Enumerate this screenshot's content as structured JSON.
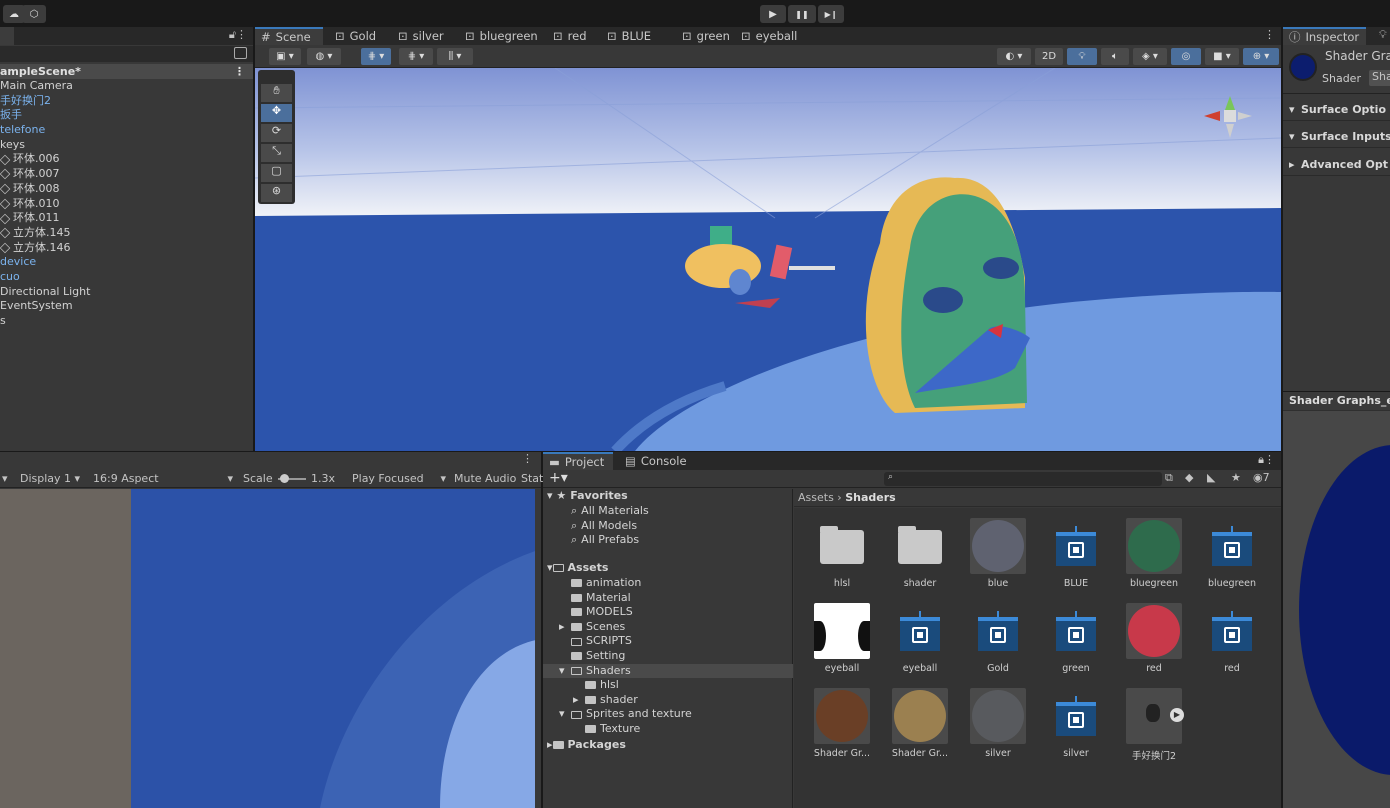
{
  "playbar": {
    "play": "▶",
    "pause": "❚❚",
    "step": "▶❙"
  },
  "hierarchy": {
    "scene": "ampleScene*",
    "items": [
      {
        "label": "Main Camera",
        "style": "normal",
        "icon": false
      },
      {
        "label": "手好换门2",
        "style": "blue",
        "icon": false
      },
      {
        "label": "扳手",
        "style": "blue",
        "icon": false
      },
      {
        "label": "telefone",
        "style": "blue",
        "icon": false
      },
      {
        "label": "keys",
        "style": "normal",
        "icon": false
      },
      {
        "label": "环体.006",
        "style": "normal",
        "icon": true
      },
      {
        "label": "环体.007",
        "style": "normal",
        "icon": true
      },
      {
        "label": "环体.008",
        "style": "normal",
        "icon": true
      },
      {
        "label": "环体.010",
        "style": "normal",
        "icon": true
      },
      {
        "label": "环体.011",
        "style": "normal",
        "icon": true
      },
      {
        "label": "立方体.145",
        "style": "normal",
        "icon": true
      },
      {
        "label": "立方体.146",
        "style": "normal",
        "icon": true
      },
      {
        "label": "device",
        "style": "blue",
        "icon": false
      },
      {
        "label": "cuo",
        "style": "blue",
        "icon": false
      },
      {
        "label": "Directional Light",
        "style": "normal",
        "icon": false
      },
      {
        "label": "EventSystem",
        "style": "normal",
        "icon": false
      },
      {
        "label": "s",
        "style": "normal",
        "icon": false
      }
    ]
  },
  "sceneTabs": [
    "Scene",
    "Gold",
    "silver",
    "bluegreen",
    "red",
    "BLUE",
    "green",
    "eyeball"
  ],
  "sceneToolbar": {
    "twoD": "2D"
  },
  "game": {
    "display": "Display 1",
    "aspect": "16:9 Aspect",
    "scale_label": "Scale",
    "scale_value": "1.3x",
    "play_focused": "Play Focused",
    "mute": "Mute Audio",
    "stats": "Stat"
  },
  "project": {
    "tabs": [
      "Project",
      "Console"
    ],
    "favorites_label": "Favorites",
    "favorites": [
      "All Materials",
      "All Models",
      "All Prefabs"
    ],
    "assets_label": "Assets",
    "folders": [
      {
        "label": "animation",
        "depth": 1
      },
      {
        "label": "Material",
        "depth": 1
      },
      {
        "label": "MODELS",
        "depth": 1
      },
      {
        "label": "Scenes",
        "depth": 1
      },
      {
        "label": "SCRIPTS",
        "depth": 1
      },
      {
        "label": "Setting",
        "depth": 1
      },
      {
        "label": "Shaders",
        "depth": 1
      },
      {
        "label": "hlsl",
        "depth": 2
      },
      {
        "label": "shader",
        "depth": 2
      },
      {
        "label": "Sprites and texture",
        "depth": 1
      },
      {
        "label": "Texture",
        "depth": 2
      }
    ],
    "packages_label": "Packages",
    "breadcrumb": [
      "Assets",
      "Shaders"
    ],
    "hidden_count": "7",
    "assets": [
      {
        "label": "hlsl",
        "kind": "folder"
      },
      {
        "label": "shader",
        "kind": "folder"
      },
      {
        "label": "blue",
        "kind": "sphere",
        "color": "#5f6270"
      },
      {
        "label": "BLUE",
        "kind": "graph"
      },
      {
        "label": "bluegreen",
        "kind": "sphere",
        "color": "#2e6b4c"
      },
      {
        "label": "bluegreen",
        "kind": "graph"
      },
      {
        "label": "eyeball",
        "kind": "texture"
      },
      {
        "label": "eyeball",
        "kind": "graph"
      },
      {
        "label": "Gold",
        "kind": "graph"
      },
      {
        "label": "green",
        "kind": "graph"
      },
      {
        "label": "red",
        "kind": "sphere",
        "color": "#c8394a"
      },
      {
        "label": "red",
        "kind": "graph"
      },
      {
        "label": "Shader Gr...",
        "kind": "sphere",
        "color": "#6a3f26"
      },
      {
        "label": "Shader Gr...",
        "kind": "sphere",
        "color": "#9b8050"
      },
      {
        "label": "silver",
        "kind": "sphere",
        "color": "#585a5e"
      },
      {
        "label": "silver",
        "kind": "graph"
      },
      {
        "label": "手好换门2",
        "kind": "model"
      }
    ]
  },
  "inspector": {
    "tab": "Inspector",
    "title": "Shader Gra",
    "shader_label": "Shader",
    "shader_value": "Sha",
    "sections": [
      "Surface Optio",
      "Surface Inputs",
      "Advanced Opt"
    ],
    "preview_title": "Shader Graphs_eye"
  }
}
